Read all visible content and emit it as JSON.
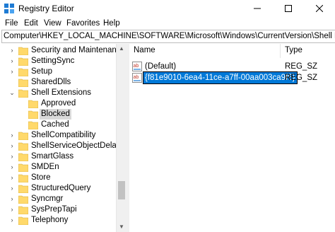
{
  "window": {
    "title": "Registry Editor",
    "controls": {
      "minimize": "minimize-icon",
      "maximize": "maximize-icon",
      "close": "close-icon"
    }
  },
  "menu": [
    "File",
    "Edit",
    "View",
    "Favorites",
    "Help"
  ],
  "address": "Computer\\HKEY_LOCAL_MACHINE\\SOFTWARE\\Microsoft\\Windows\\CurrentVersion\\Shell Extensions\\Blo",
  "tree": [
    {
      "label": "Security and Maintenance",
      "expander": "collapsed"
    },
    {
      "label": "SettingSync",
      "expander": "collapsed"
    },
    {
      "label": "Setup",
      "expander": "collapsed"
    },
    {
      "label": "SharedDlls",
      "expander": "none"
    },
    {
      "label": "Shell Extensions",
      "expander": "expanded"
    },
    {
      "label": "Approved",
      "expander": "none"
    },
    {
      "label": "Blocked",
      "expander": "none",
      "selected": true
    },
    {
      "label": "Cached",
      "expander": "none"
    },
    {
      "label": "ShellCompatibility",
      "expander": "collapsed"
    },
    {
      "label": "ShellServiceObjectDelayLoa",
      "expander": "collapsed"
    },
    {
      "label": "SmartGlass",
      "expander": "collapsed"
    },
    {
      "label": "SMDEn",
      "expander": "collapsed"
    },
    {
      "label": "Store",
      "expander": "collapsed"
    },
    {
      "label": "StructuredQuery",
      "expander": "collapsed"
    },
    {
      "label": "Syncmgr",
      "expander": "collapsed"
    },
    {
      "label": "SysPrepTapi",
      "expander": "collapsed"
    },
    {
      "label": "Telephony",
      "expander": "collapsed"
    }
  ],
  "list": {
    "columns": [
      "Name",
      "Type"
    ],
    "rows": [
      {
        "name": "(Default)",
        "type": "REG_SZ",
        "icon": "string-value-icon",
        "editing": false
      },
      {
        "name": "{f81e9010-6ea4-11ce-a7ff-00aa003ca9f6}",
        "type": "REG_SZ",
        "icon": "string-value-icon",
        "editing": true
      }
    ]
  },
  "colors": {
    "selection_blue": "#0078d7",
    "tree_selected": "#d9d9d9",
    "folder_yellow": "#ffd96b"
  }
}
